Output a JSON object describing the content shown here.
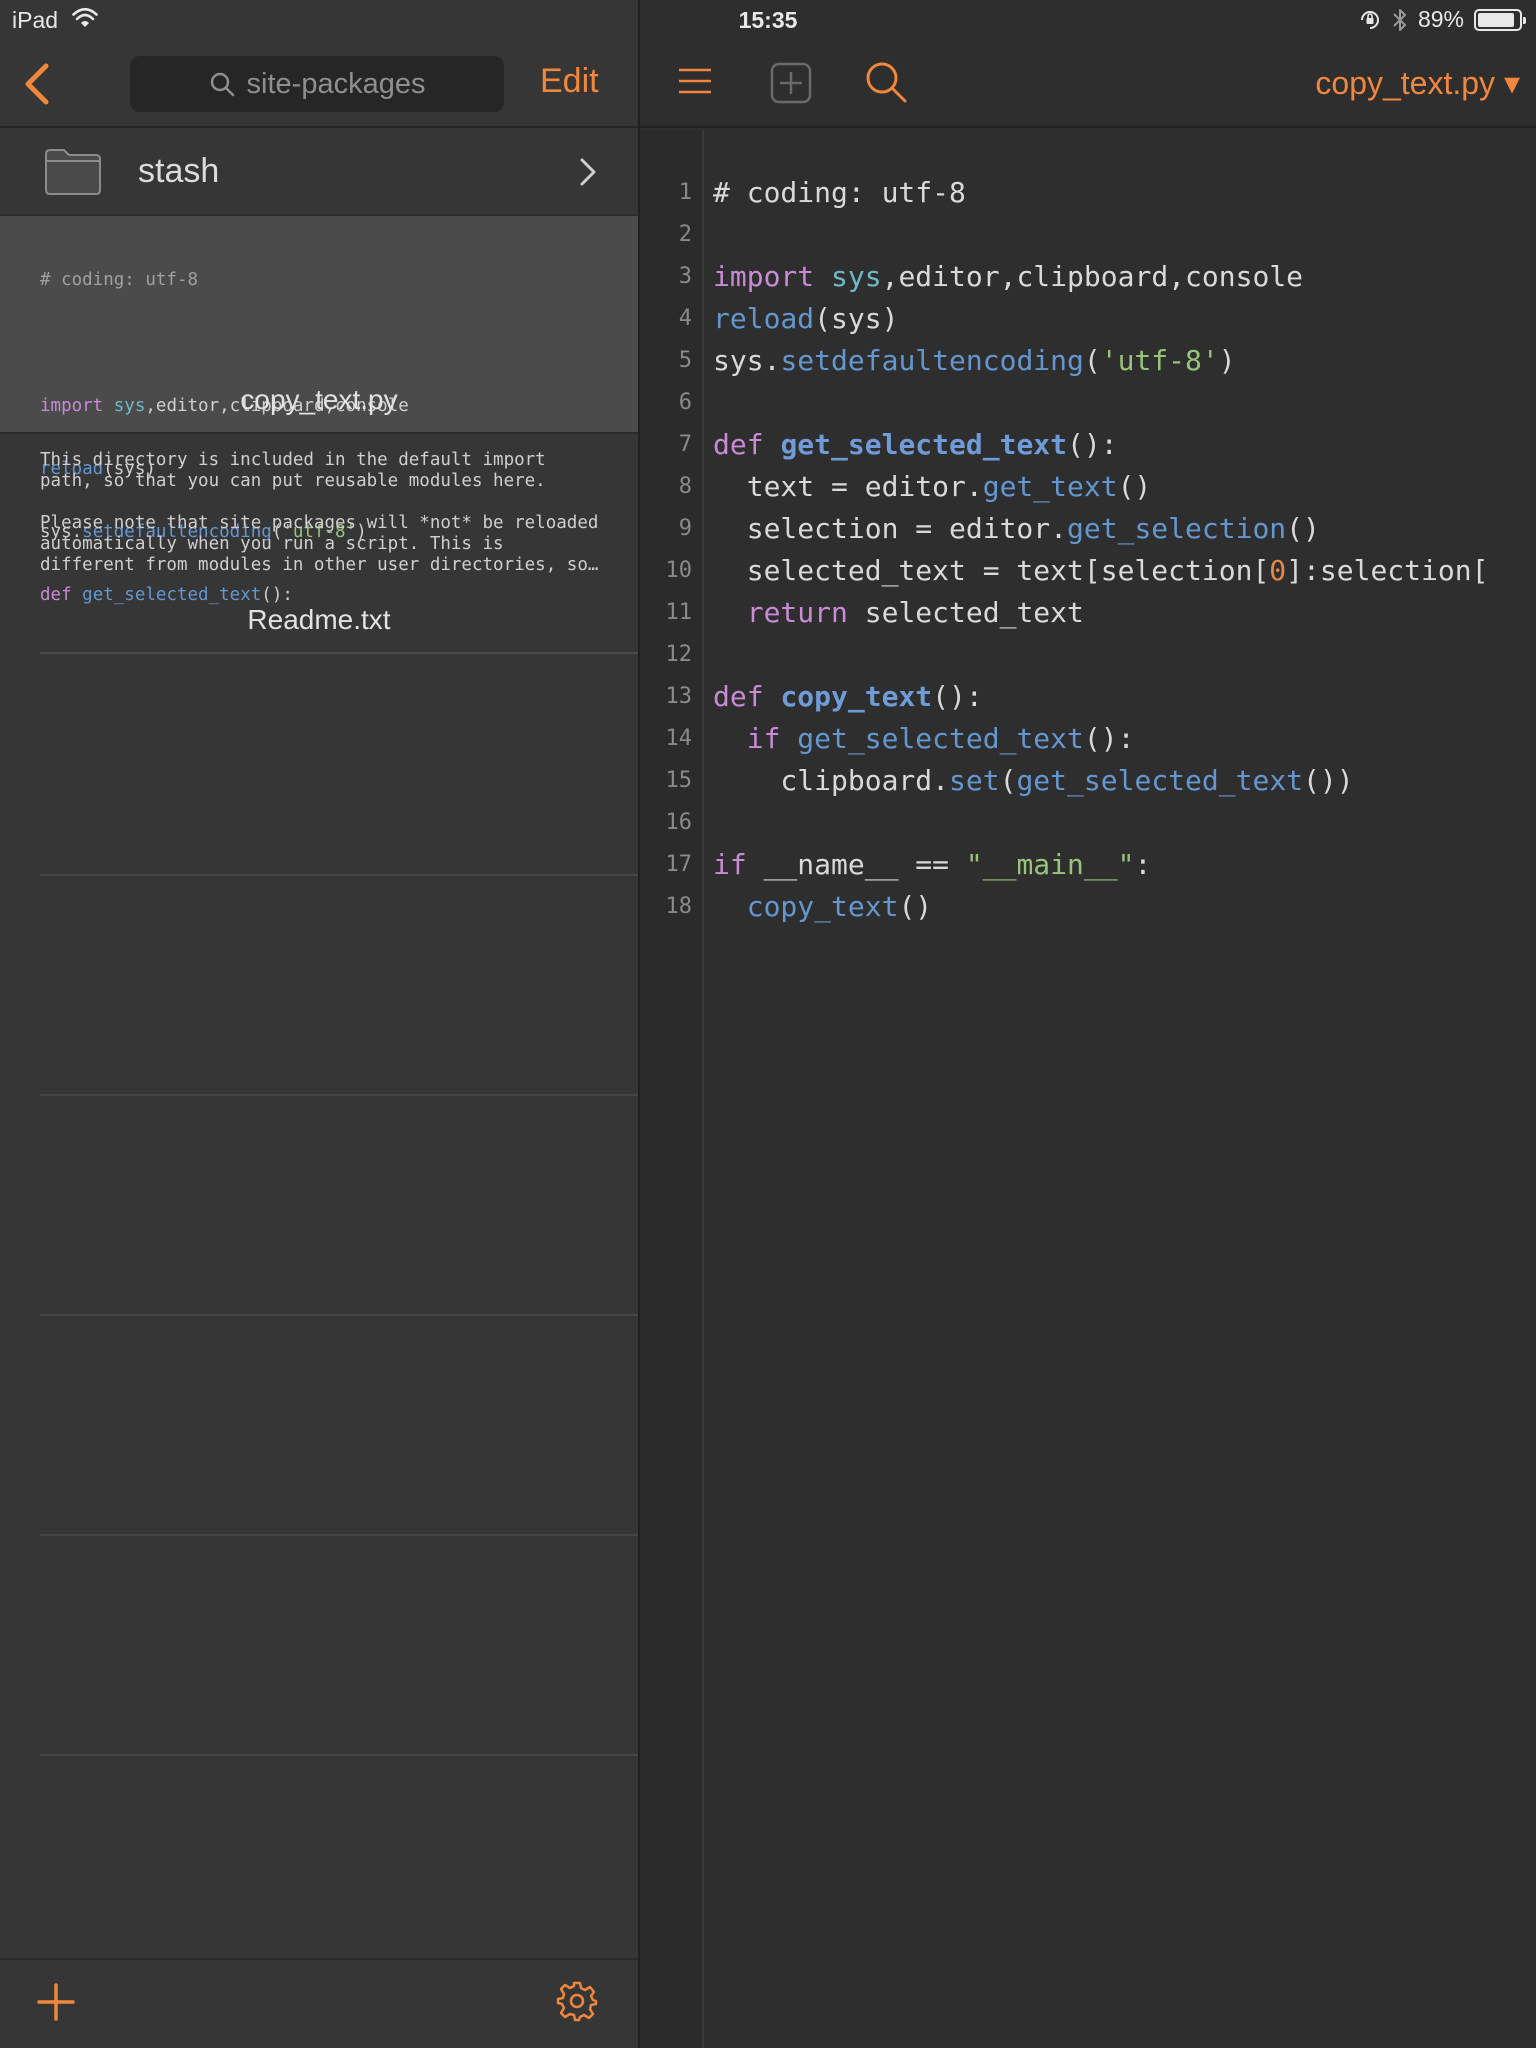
{
  "status_bar": {
    "device": "iPad",
    "time": "15:35",
    "battery": "89%",
    "battery_level": 0.89
  },
  "browser": {
    "search_placeholder": "site-packages",
    "edit_label": "Edit",
    "folder": {
      "name": "stash",
      "icon": "folder-icon"
    },
    "files": [
      {
        "name": "copy_text.py",
        "selected": true,
        "preview": [
          "# coding: utf-8",
          "",
          "import sys,editor,clipboard,console",
          "reload(sys)",
          "sys.setdefaultencoding('utf-8')",
          "def get_selected_text():"
        ]
      },
      {
        "name": "Readme.txt",
        "selected": false,
        "preview": [
          "This directory is included in the default import",
          "path, so that you can put reusable modules here.",
          "",
          "Please note that site packages will *not* be reloaded",
          "automatically when you run a script. This is",
          "different from modules in other user directories, so…"
        ]
      }
    ]
  },
  "editor": {
    "title": "copy_text.py ▾",
    "lines": [
      "# coding: utf-8",
      "",
      "import sys,editor,clipboard,console",
      "reload(sys)",
      "sys.setdefaultencoding('utf-8')",
      "",
      "def get_selected_text():",
      "  text = editor.get_text()",
      "  selection = editor.get_selection()",
      "  selected_text = text[selection[0]:selection[",
      "  return selected_text",
      "",
      "def copy_text():",
      "  if get_selected_text():",
      "    clipboard.set(get_selected_text())",
      "",
      "if __name__ == \"__main__\":",
      "  copy_text()"
    ]
  },
  "colors": {
    "accent": "#f0873c",
    "keyword": "#c98ad6",
    "builtin": "#6fb8c9",
    "function": "#6497d0",
    "string": "#98c379",
    "number": "#e5894a"
  }
}
